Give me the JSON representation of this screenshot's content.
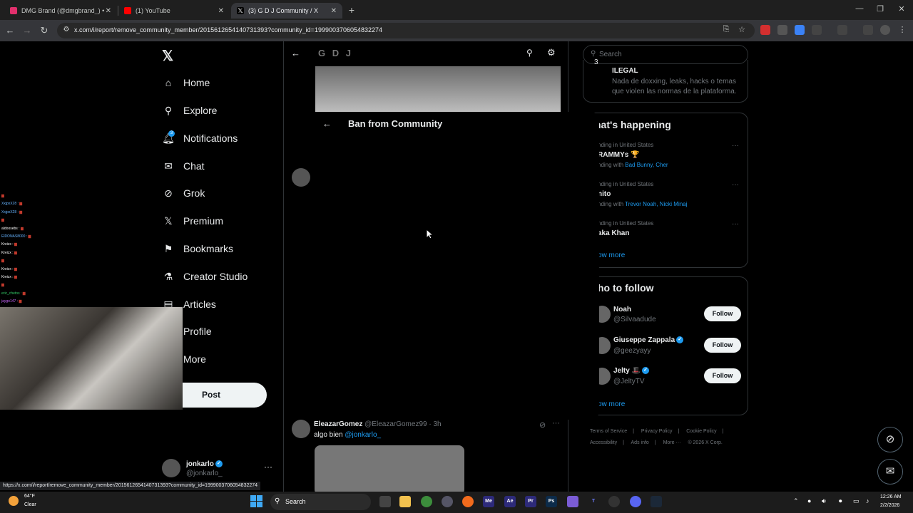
{
  "browser": {
    "tabs": [
      {
        "title": "DMG Brand (@dmgbrand_) • In",
        "favicon_color": "#e1306c"
      },
      {
        "title": "(1) YouTube",
        "favicon_color": "#ff0000"
      },
      {
        "title": "(3) G D J Community / X",
        "favicon_color": "#000000"
      }
    ],
    "url": "x.com/i/report/remove_community_member/2015612654140731393?community_id=1999003706054832274",
    "status_url": "https://x.com/i/report/remove_community_member/2015612654140731393?community_id=1999003706054832274"
  },
  "sidebar": {
    "items": [
      {
        "label": "Home",
        "icon": "home-icon"
      },
      {
        "label": "Explore",
        "icon": "search-icon"
      },
      {
        "label": "Notifications",
        "icon": "bell-icon"
      },
      {
        "label": "Chat",
        "icon": "mail-icon"
      },
      {
        "label": "Grok",
        "icon": "grok-icon"
      },
      {
        "label": "Premium",
        "icon": "x-icon"
      },
      {
        "label": "Bookmarks",
        "icon": "bookmark-icon"
      },
      {
        "label": "Creator Studio",
        "icon": "flask-icon"
      },
      {
        "label": "Articles",
        "icon": "article-icon"
      },
      {
        "label": "Profile",
        "icon": "person-icon"
      },
      {
        "label": "More",
        "icon": "more-icon"
      }
    ],
    "notifications_count": "3",
    "post_label": "Post",
    "account": {
      "name": "jonkarlo",
      "handle": "@jonkarlo_"
    }
  },
  "main": {
    "header_title": "G D J",
    "tweet": {
      "author": "EleazarGomez",
      "handle": "@EleazarGomez99",
      "time": "· 3h",
      "text": "algo bien",
      "mention": "@jonkarlo_"
    }
  },
  "modal": {
    "title": "Ban from Community"
  },
  "right": {
    "search_placeholder": "Search",
    "rule": {
      "number": "3",
      "title": "ILEGAL",
      "description": "Nada de doxxing, leaks, hacks o temas que violen las normas de la plataforma."
    },
    "happening_title": "hat's happening",
    "trends": [
      {
        "context": "nding in United States",
        "name": "RAMMYs 🏆",
        "with_prefix": "nding with",
        "with": "Bad Bunny, Cher"
      },
      {
        "context": "nding in United States",
        "name": "nito",
        "with_prefix": "nding with",
        "with": "Trevor Noah, Nicki Minaj"
      },
      {
        "context": "nding in United States",
        "name": "aka Khan",
        "with_prefix": "",
        "with": ""
      }
    ],
    "show_more": "ow more",
    "follow_title": "ho to follow",
    "follows": [
      {
        "name": "Noah",
        "handle": "@Silvaadude",
        "button": "Follow"
      },
      {
        "name": "Giuseppe Zappala",
        "handle": "@geezyayy",
        "button": "Follow"
      },
      {
        "name": "Jelty 🎩",
        "handle": "@JeltyTV",
        "button": "Follow"
      }
    ],
    "show_more_2": "ow more",
    "footer": [
      "Terms of Service",
      "|",
      "Privacy Policy",
      "|",
      "Cookie Policy",
      "|",
      "Accessibility",
      "|",
      "Ads info",
      "|",
      "More ···",
      "© 2026 X Corp."
    ]
  },
  "chat_overlay": [
    {
      "user": "",
      "color": "#ff4040"
    },
    {
      "user": "XxjpxX28 :",
      "color": "#66b3ff"
    },
    {
      "user": "XxjpxX28 :",
      "color": "#66b3ff"
    },
    {
      "user": "",
      "color": "#ff4040"
    },
    {
      "user": "aldoosebs :",
      "color": "#ffffff"
    },
    {
      "user": "ElDONAS8000 :",
      "color": "#66b3ff"
    },
    {
      "user": "Kreizx :",
      "color": "#ffffff"
    },
    {
      "user": "Kreizx :",
      "color": "#ffffff"
    },
    {
      "user": "",
      "color": "#ff4040"
    },
    {
      "user": "Kreizx :",
      "color": "#ffffff"
    },
    {
      "user": "Kreizx :",
      "color": "#ffffff"
    },
    {
      "user": "",
      "color": "#ff4040"
    },
    {
      "user": "eric_chetos :",
      "color": "#33cc66"
    },
    {
      "user": "jaygo147 :",
      "color": "#cc66ff"
    }
  ],
  "taskbar": {
    "weather_temp": "64°F",
    "weather_cond": "Clear",
    "search_label": "Search",
    "time": "12:26 AM",
    "date": "2/2/2026"
  }
}
